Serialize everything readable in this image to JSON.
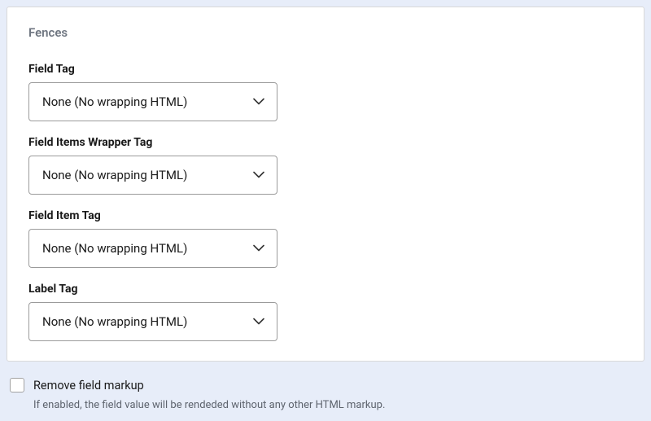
{
  "panel": {
    "title": "Fences",
    "fields": [
      {
        "label": "Field Tag",
        "value": "None (No wrapping HTML)"
      },
      {
        "label": "Field Items Wrapper Tag",
        "value": "None (No wrapping HTML)"
      },
      {
        "label": "Field Item Tag",
        "value": "None (No wrapping HTML)"
      },
      {
        "label": "Label Tag",
        "value": "None (No wrapping HTML)"
      }
    ]
  },
  "remove_markup": {
    "label": "Remove field markup",
    "helper": "If enabled, the field value will be rendeded without any other HTML markup."
  }
}
